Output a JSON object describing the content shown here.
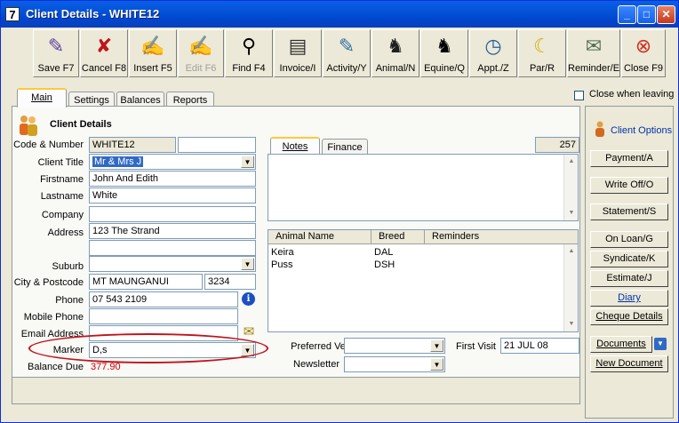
{
  "window": {
    "title": "Client Details - WHITE12",
    "app_icon": "7"
  },
  "toolbar": [
    {
      "label": "Save F7",
      "icon": "quill-icon",
      "glyph": "✎",
      "color": "#5a3fa0"
    },
    {
      "label": "Cancel F8",
      "icon": "red-x-icon",
      "glyph": "✘",
      "color": "#c0141c"
    },
    {
      "label": "Insert F5",
      "icon": "pencil-paper-icon",
      "glyph": "✍",
      "color": "#806000"
    },
    {
      "label": "Edit F6",
      "icon": "edit-paper-icon",
      "glyph": "✍",
      "color": "#a0a0a0",
      "disabled": true
    },
    {
      "label": "Find F4",
      "icon": "magnifier-icon",
      "glyph": "⚲",
      "color": "#000000"
    },
    {
      "label": "Invoice/I",
      "icon": "invoice-icon",
      "glyph": "▤",
      "color": "#303030"
    },
    {
      "label": "Activity/Y",
      "icon": "activity-icon",
      "glyph": "✎",
      "color": "#2f6f9f"
    },
    {
      "label": "Animal/N",
      "icon": "dog-icon",
      "glyph": "♞",
      "color": "#202020"
    },
    {
      "label": "Equine/Q",
      "icon": "horse-icon",
      "glyph": "♞",
      "color": "#000000"
    },
    {
      "label": "Appt./Z",
      "icon": "clock-icon",
      "glyph": "◷",
      "color": "#1f5f9f"
    },
    {
      "label": "Par/R",
      "icon": "banana-icon",
      "glyph": "☾",
      "color": "#d0b000"
    },
    {
      "label": "Reminder/E",
      "icon": "reminder-icon",
      "glyph": "✉",
      "color": "#507050"
    },
    {
      "label": "Close F9",
      "icon": "close-circle-icon",
      "glyph": "⊗",
      "color": "#d03020"
    }
  ],
  "tabs": {
    "main": "Main",
    "settings": "Settings",
    "balances": "Balances",
    "reports": "Reports"
  },
  "close_when_leaving": {
    "label": "Close when leaving",
    "checked": false
  },
  "client": {
    "section_title": "Client Details",
    "code_label": "Code & Number",
    "code": "WHITE12",
    "number": "",
    "title_label": "Client Title",
    "title": "Mr & Mrs J",
    "firstname_label": "Firstname",
    "firstname": "John And Edith",
    "lastname_label": "Lastname",
    "lastname": "White",
    "company_label": "Company",
    "company": "",
    "address_label": "Address",
    "address1": "123 The Strand",
    "address2": "",
    "suburb_label": "Suburb",
    "suburb": "",
    "city_label": "City & Postcode",
    "city": "MT MAUNGANUI",
    "postcode": "3234",
    "phone_label": "Phone",
    "phone": "07 543 2109",
    "mobile_label": "Mobile Phone",
    "mobile": "",
    "email_label": "Email Address",
    "email": "",
    "marker_label": "Marker",
    "marker": "D,s",
    "balance_label": "Balance Due",
    "balance": "377.90"
  },
  "notes_tabs": {
    "notes": "Notes",
    "finance": "Finance",
    "count": "257"
  },
  "animals": {
    "headers": [
      "Animal Name",
      "Breed",
      "Reminders"
    ],
    "rows": [
      {
        "name": "Keira",
        "breed": "DAL",
        "reminders": ""
      },
      {
        "name": "Puss",
        "breed": "DSH",
        "reminders": ""
      }
    ]
  },
  "preferred_vet": {
    "label": "Preferred Vet",
    "value": ""
  },
  "newsletter": {
    "label": "Newsletter",
    "value": ""
  },
  "first_visit": {
    "label": "First Visit",
    "value": "21 JUL 08"
  },
  "client_options": {
    "title": "Client Options",
    "buttons": [
      "Payment/A",
      "Write Off/O",
      "Statement/S",
      "On Loan/G",
      "Syndicate/K",
      "Estimate/J",
      "Diary",
      "Cheque Details",
      "Documents",
      "New Document"
    ]
  },
  "colors": {
    "balance": "#cc0000",
    "highlight_ellipse": "#c0141c",
    "title_bar": "#0054e3"
  }
}
